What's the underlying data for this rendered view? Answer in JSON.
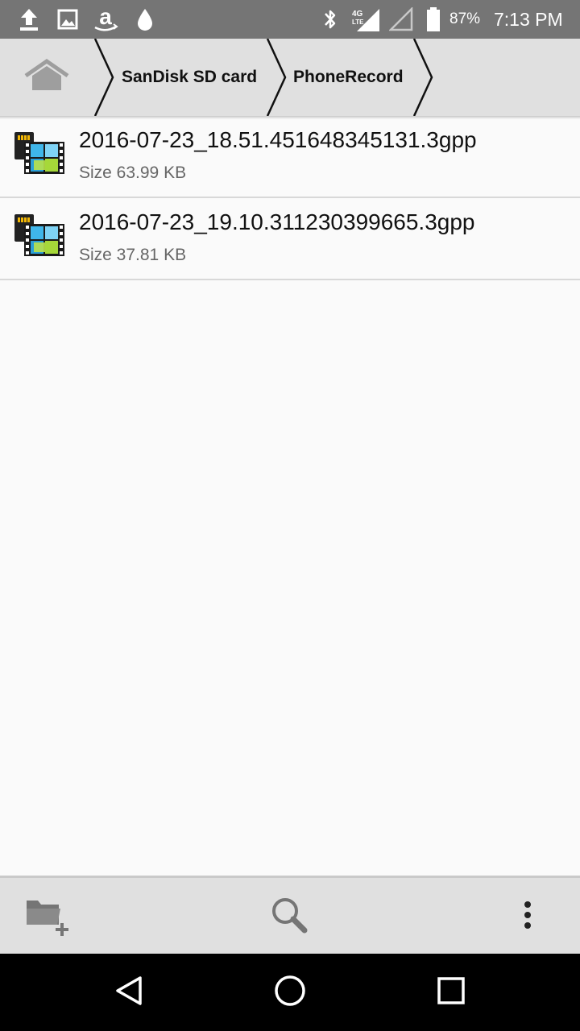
{
  "status_bar": {
    "battery_percent": "87%",
    "time": "7:13 PM",
    "network_label": "4G LTE",
    "icons": [
      "upload-icon",
      "image-icon",
      "amazon-icon",
      "drop-icon",
      "bluetooth-icon",
      "signal-4g-icon",
      "signal-empty-icon",
      "battery-icon"
    ]
  },
  "breadcrumb": {
    "home_icon": "home-icon",
    "items": [
      {
        "label": "SanDisk SD card"
      },
      {
        "label": "PhoneRecord"
      }
    ]
  },
  "files": [
    {
      "name": "2016-07-23_18.51.451648345131.3gpp",
      "size": "Size 63.99 KB",
      "icon": "video-file-icon"
    },
    {
      "name": "2016-07-23_19.10.311230399665.3gpp",
      "size": "Size 37.81 KB",
      "icon": "video-file-icon"
    }
  ],
  "toolbar": {
    "new_folder_icon": "new-folder-icon",
    "search_icon": "search-icon",
    "more_icon": "more-vert-icon"
  },
  "nav": {
    "back_icon": "back-icon",
    "home_icon": "home-circle-icon",
    "recents_icon": "recents-icon"
  },
  "colors": {
    "status_bar": "#757575",
    "header": "#e0e0e0",
    "background": "#fafafa",
    "nav_bar": "#000000"
  }
}
